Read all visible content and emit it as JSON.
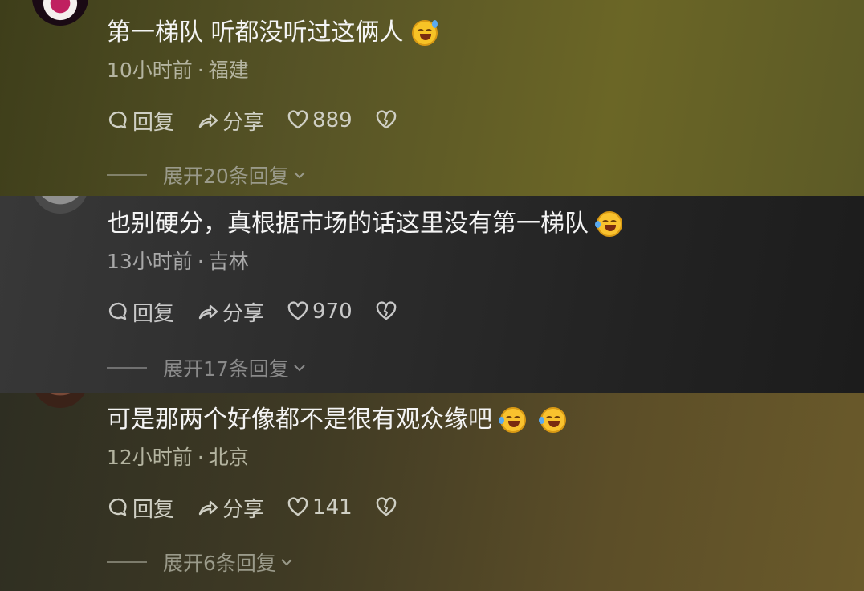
{
  "comments": [
    {
      "text": "第一梯队 听都没听过这俩人",
      "emoji_icons": [
        "sweat-smile-emoji"
      ],
      "time": "10小时前",
      "location": "福建",
      "reply_label": "回复",
      "share_label": "分享",
      "likes": "889",
      "expand_label": "展开20条回复"
    },
    {
      "text": "也别硬分，真根据市场的话这里没有第一梯队",
      "emoji_icons": [
        "laugh-tears-emoji"
      ],
      "time": "13小时前",
      "location": "吉林",
      "reply_label": "回复",
      "share_label": "分享",
      "likes": "970",
      "expand_label": "展开17条回复"
    },
    {
      "text": "可是那两个好像都不是很有观众缘吧",
      "emoji_icons": [
        "laugh-tears-emoji",
        "laugh-tears-emoji"
      ],
      "time": "12小时前",
      "location": "北京",
      "reply_label": "回复",
      "share_label": "分享",
      "likes": "141",
      "expand_label": "展开6条回复"
    }
  ],
  "meta_separator": "·"
}
